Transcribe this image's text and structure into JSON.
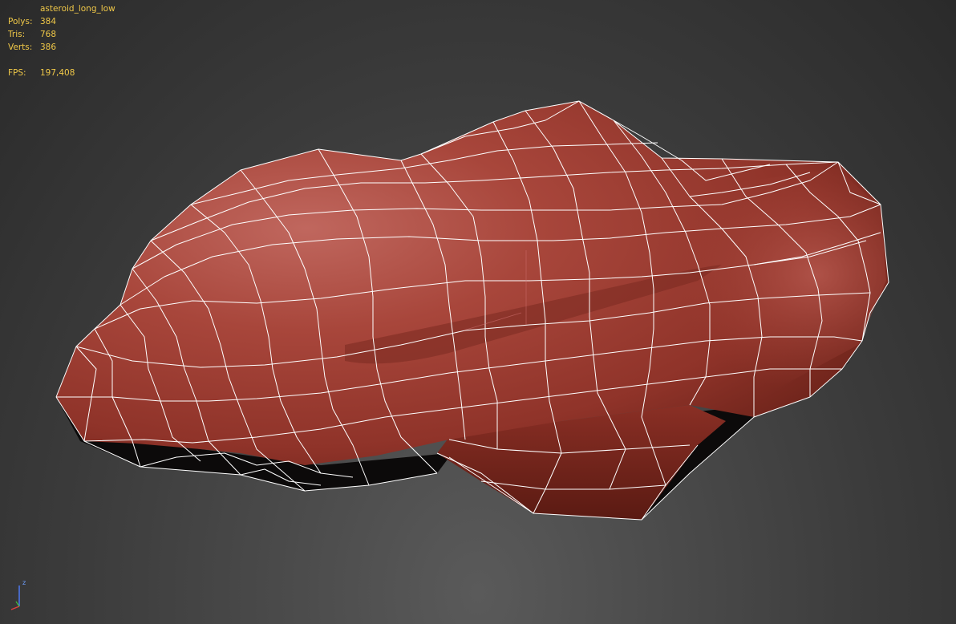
{
  "stats": {
    "object_name": "asteroid_long_low",
    "polys_label": "Polys:",
    "polys_value": "384",
    "tris_label": "Tris:",
    "tris_value": "768",
    "verts_label": "Verts:",
    "verts_value": "386",
    "fps_label": "FPS:",
    "fps_value": "197,408"
  },
  "gizmo": {
    "z_label": "z"
  },
  "colors": {
    "stats_text": "#f0c848",
    "mesh_base": "#9c3b30",
    "mesh_highlight": "#c0675e",
    "wire": "#ffffff",
    "background": "#3a3a3a"
  }
}
